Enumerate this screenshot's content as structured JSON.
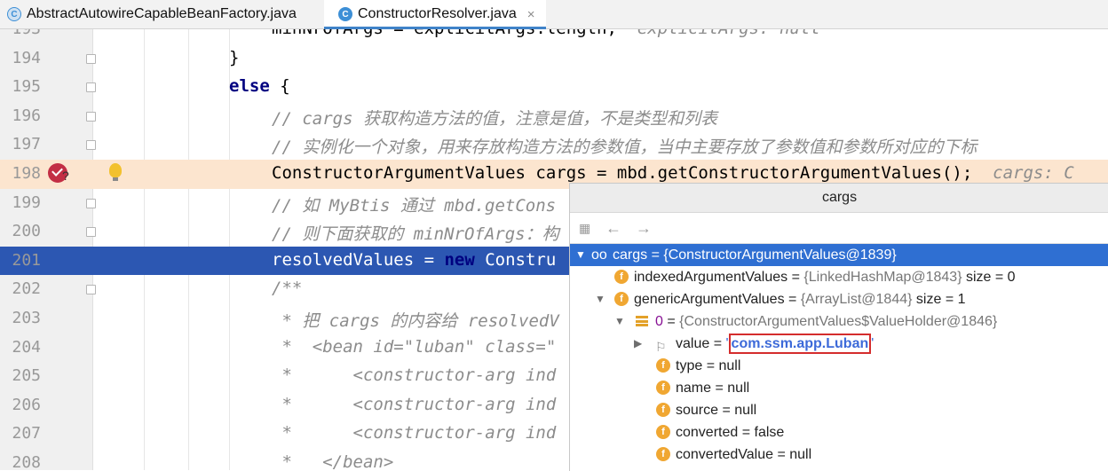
{
  "tabs": [
    {
      "label": "AbstractAutowireCapableBeanFactory.java",
      "icon": "class-icon",
      "active": false
    },
    {
      "label": "ConstructorResolver.java",
      "icon": "class-icon",
      "active": true,
      "close": "×"
    }
  ],
  "editor": {
    "lines": [
      {
        "number": "",
        "seg": [
          {
            "t": "minNrOfArgs = explicitArgs.length;",
            "c": ""
          },
          {
            "t": "  explicitArgs: null",
            "c": "hint"
          }
        ],
        "indent": 48
      },
      {
        "number": "194",
        "seg": [
          {
            "t": "}",
            "c": ""
          }
        ],
        "indent": 0
      },
      {
        "number": "195",
        "seg": [
          {
            "t": "else",
            "c": "kw"
          },
          {
            "t": " {",
            "c": ""
          }
        ],
        "indent": 0
      },
      {
        "number": "196",
        "seg": [
          {
            "t": "// cargs 获取构造方法的值，注意是值，不是类型和列表",
            "c": "cm"
          }
        ],
        "indent": 48
      },
      {
        "number": "197",
        "seg": [
          {
            "t": "// 实例化一个对象，用来存放构造方法的参数值，当中主要存放了参数值和参数所对应的下标",
            "c": "cm"
          }
        ],
        "indent": 48
      },
      {
        "number": "198",
        "seg": [
          {
            "t": "ConstructorArgumentValues cargs = mbd.getConstructorArgumentValues();",
            "c": ""
          },
          {
            "t": "  cargs: C",
            "c": "hint"
          }
        ],
        "indent": 48
      },
      {
        "number": "199",
        "seg": [
          {
            "t": "// 如 MyBtis 通过 mbd.getCons",
            "c": "cm"
          }
        ],
        "indent": 48
      },
      {
        "number": "200",
        "seg": [
          {
            "t": "// 则下面获取的 minNrOfArgs：构",
            "c": "cm"
          }
        ],
        "indent": 48
      },
      {
        "number": "201",
        "seg": [
          {
            "t": "resolvedValues = ",
            "c": ""
          },
          {
            "t": "new",
            "c": "kw"
          },
          {
            "t": " Constru",
            "c": ""
          }
        ],
        "indent": 48
      },
      {
        "number": "202",
        "seg": [
          {
            "t": "/**",
            "c": "cm"
          }
        ],
        "indent": 48
      },
      {
        "number": "203",
        "seg": [
          {
            "t": " * 把 cargs 的内容给 resolvedV",
            "c": "cm"
          }
        ],
        "indent": 48
      },
      {
        "number": "204",
        "seg": [
          {
            "t": " *  <bean id=\"luban\" class=\"",
            "c": "cm"
          }
        ],
        "indent": 48
      },
      {
        "number": "205",
        "seg": [
          {
            "t": " *      <constructor-arg ind",
            "c": "cm"
          }
        ],
        "indent": 48
      },
      {
        "number": "206",
        "seg": [
          {
            "t": " *      <constructor-arg ind",
            "c": "cm"
          }
        ],
        "indent": 48
      },
      {
        "number": "207",
        "seg": [
          {
            "t": " *      <constructor-arg ind",
            "c": "cm"
          }
        ],
        "indent": 48
      },
      {
        "number": "208",
        "seg": [
          {
            "t": " *   </bean>",
            "c": "cm"
          }
        ],
        "indent": 48
      }
    ],
    "partial_line_number": "193"
  },
  "popup": {
    "title": "cargs",
    "toolbar": {
      "back": "←",
      "forward": "→"
    },
    "tree": [
      {
        "name": "cargs",
        "value": "{ConstructorArgumentValues@1839}",
        "extra": "",
        "icon": "watch-icon",
        "arrow": "▼",
        "selected": true
      },
      {
        "name": "indexedArgumentValues",
        "value": "{LinkedHashMap@1843}",
        "extra": "size = 0",
        "icon": "field-icon",
        "arrow": "",
        "selected": false
      },
      {
        "name": "genericArgumentValues",
        "value": "{ArrayList@1844}",
        "extra": "size = 1",
        "icon": "field-icon",
        "arrow": "▼",
        "selected": false
      },
      {
        "name": "0",
        "value": "{ConstructorArgumentValues$ValueHolder@1846}",
        "extra": "",
        "icon": "list-icon",
        "arrow": "▼",
        "selected": false
      },
      {
        "name": "value",
        "value": "com.ssm.app.Luban",
        "extra": "",
        "icon": "flag-icon",
        "arrow": "▶",
        "selected": false,
        "quoted": true
      },
      {
        "name": "type",
        "value": "null",
        "extra": "",
        "icon": "field-icon",
        "arrow": "",
        "selected": false
      },
      {
        "name": "name",
        "value": "null",
        "extra": "",
        "icon": "field-icon",
        "arrow": "",
        "selected": false
      },
      {
        "name": "source",
        "value": "null",
        "extra": "",
        "icon": "field-icon",
        "arrow": "",
        "selected": false
      },
      {
        "name": "converted",
        "value": "false",
        "extra": "",
        "icon": "field-icon",
        "arrow": "",
        "selected": false
      },
      {
        "name": "convertedValue",
        "value": "null",
        "extra": "",
        "icon": "field-icon",
        "arrow": "",
        "selected": false
      }
    ]
  },
  "colors": {
    "selection": "#2c57b2",
    "current_line": "#fce5cf",
    "breakpoint": "#c32e44",
    "tab_accent": "#4083c9"
  }
}
